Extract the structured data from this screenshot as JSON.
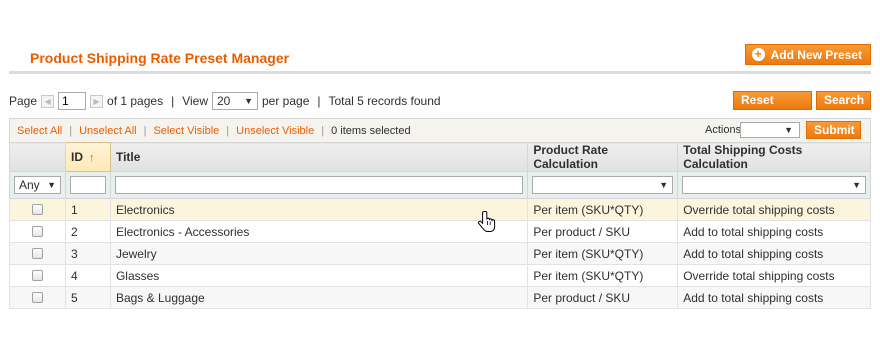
{
  "header": {
    "title": "Product Shipping Rate Preset Manager",
    "add_button": "Add New Preset"
  },
  "pager": {
    "page_label": "Page",
    "current_page": "1",
    "of_pages": "of 1 pages",
    "view_label": "View",
    "per_page_value": "20",
    "per_page_label": "per page",
    "total": "Total 5 records found"
  },
  "buttons": {
    "reset": "Reset Filter",
    "search": "Search",
    "submit": "Submit"
  },
  "massaction": {
    "select_all": "Select All",
    "unselect_all": "Unselect All",
    "select_visible": "Select Visible",
    "unselect_visible": "Unselect Visible",
    "items_selected": "0 items selected",
    "actions_label": "Actions"
  },
  "columns": {
    "id": "ID",
    "title": "Title",
    "product_rate": "Product Rate Calculation",
    "total_shipping": "Total Shipping Costs Calculation"
  },
  "filter": {
    "any": "Any"
  },
  "rows": [
    {
      "id": "1",
      "title": "Electronics",
      "rate": "Per item (SKU*QTY)",
      "total": "Override total shipping costs"
    },
    {
      "id": "2",
      "title": "Electronics - Accessories",
      "rate": "Per product / SKU",
      "total": "Add to total shipping costs"
    },
    {
      "id": "3",
      "title": "Jewelry",
      "rate": "Per item (SKU*QTY)",
      "total": "Add to total shipping costs"
    },
    {
      "id": "4",
      "title": "Glasses",
      "rate": "Per item (SKU*QTY)",
      "total": "Override total shipping costs"
    },
    {
      "id": "5",
      "title": "Bags & Luggage",
      "rate": "Per product / SKU",
      "total": "Add to total shipping costs"
    }
  ],
  "colors": {
    "accent": "#eb5e00",
    "button": "#ec7a0c",
    "hover_row": "#fcf5dd"
  }
}
